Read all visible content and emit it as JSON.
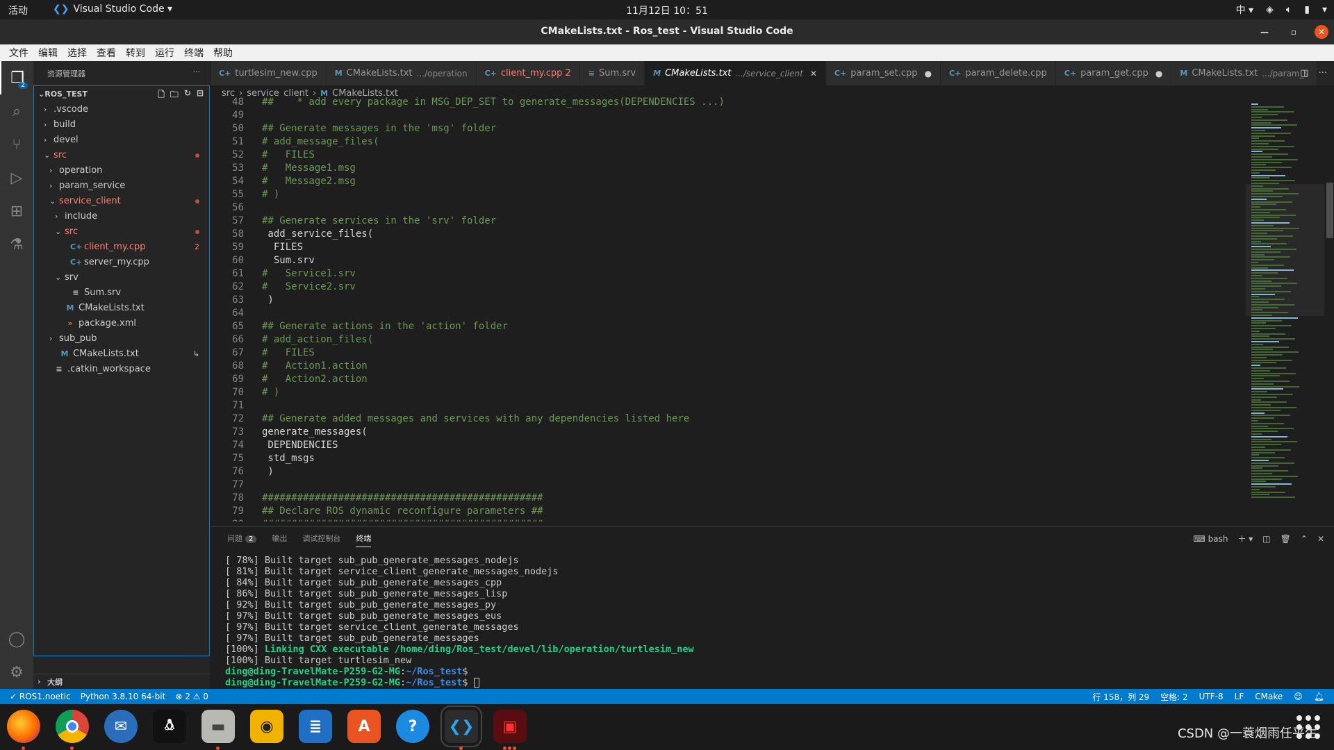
{
  "topbar": {
    "activities": "活动",
    "app_name": "Visual Studio Code ▾",
    "clock": "11月12日  10：51",
    "input_method": "中 ▾"
  },
  "window": {
    "title": "CMakeLists.txt - Ros_test - Visual Studio Code"
  },
  "menu": [
    "文件",
    "编辑",
    "选择",
    "查看",
    "转到",
    "运行",
    "终端",
    "帮助"
  ],
  "activity": {
    "explorer_badge": "2"
  },
  "sidebar": {
    "header": "资源管理器",
    "more": "···",
    "section": "ROS_TEST",
    "outline": "大纲",
    "tree": [
      {
        "depth": 0,
        "label": ".vscode",
        "chev": "›",
        "icon": "",
        "cls": ""
      },
      {
        "depth": 0,
        "label": "build",
        "chev": "›",
        "icon": "",
        "cls": ""
      },
      {
        "depth": 0,
        "label": "devel",
        "chev": "›",
        "icon": "",
        "cls": ""
      },
      {
        "depth": 0,
        "label": "src",
        "chev": "⌄",
        "icon": "",
        "cls": "err",
        "deco": "dot"
      },
      {
        "depth": 1,
        "label": "operation",
        "chev": "›",
        "icon": "",
        "cls": ""
      },
      {
        "depth": 1,
        "label": "param_service",
        "chev": "›",
        "icon": "",
        "cls": ""
      },
      {
        "depth": 1,
        "label": "service_client",
        "chev": "⌄",
        "icon": "",
        "cls": "err",
        "deco": "dot"
      },
      {
        "depth": 2,
        "label": "include",
        "chev": "›",
        "icon": "",
        "cls": ""
      },
      {
        "depth": 2,
        "label": "src",
        "chev": "⌄",
        "icon": "",
        "cls": "err",
        "deco": "dot"
      },
      {
        "depth": 3,
        "label": "client_my.cpp",
        "chev": "",
        "icon": "C+",
        "cls": "err",
        "deco": "2"
      },
      {
        "depth": 3,
        "label": "server_my.cpp",
        "chev": "",
        "icon": "C+",
        "cls": ""
      },
      {
        "depth": 2,
        "label": "srv",
        "chev": "⌄",
        "icon": "",
        "cls": ""
      },
      {
        "depth": 3,
        "label": "Sum.srv",
        "chev": "",
        "icon": "≡",
        "cls": ""
      },
      {
        "depth": 2,
        "label": "CMakeLists.txt",
        "chev": "",
        "icon": "M",
        "cls": ""
      },
      {
        "depth": 2,
        "label": "package.xml",
        "chev": "",
        "icon": "»",
        "cls": ""
      },
      {
        "depth": 1,
        "label": "sub_pub",
        "chev": "›",
        "icon": "",
        "cls": ""
      },
      {
        "depth": 1,
        "label": "CMakeLists.txt",
        "chev": "",
        "icon": "M",
        "cls": "",
        "deco": "↳"
      },
      {
        "depth": 0,
        "label": ".catkin_workspace",
        "chev": "",
        "icon": "≡",
        "cls": ""
      }
    ]
  },
  "tabs": [
    {
      "label": "turtlesim_new.cpp",
      "icon": "C+",
      "desc": "",
      "state": ""
    },
    {
      "label": "CMakeLists.txt",
      "icon": "M",
      "desc": ".../operation",
      "state": ""
    },
    {
      "label": "client_my.cpp 2",
      "icon": "C+",
      "desc": "",
      "state": "",
      "error": true
    },
    {
      "label": "Sum.srv",
      "icon": "≡",
      "desc": "",
      "state": ""
    },
    {
      "label": "CMakeLists.txt",
      "icon": "M",
      "desc": ".../service_client",
      "state": "✕",
      "active": true
    },
    {
      "label": "param_set.cpp",
      "icon": "C+",
      "desc": "",
      "state": "●"
    },
    {
      "label": "param_delete.cpp",
      "icon": "C+",
      "desc": "",
      "state": ""
    },
    {
      "label": "param_get.cpp",
      "icon": "C+",
      "desc": "",
      "state": "●"
    },
    {
      "label": "CMakeLists.txt",
      "icon": "M",
      "desc": ".../param_s",
      "state": ""
    }
  ],
  "breadcrumb": [
    "src",
    "›",
    "service_client",
    "›",
    "M",
    "CMakeLists.txt"
  ],
  "editor": {
    "lines": [
      {
        "n": "48",
        "t": "##    * add every package in MSG_DEP_SET to generate_messages(DEPENDENCIES ...)",
        "c": true
      },
      {
        "n": "49",
        "t": "",
        "c": false
      },
      {
        "n": "50",
        "t": "## Generate messages in the 'msg' folder",
        "c": true
      },
      {
        "n": "51",
        "t": "# add_message_files(",
        "c": true
      },
      {
        "n": "52",
        "t": "#   FILES",
        "c": true
      },
      {
        "n": "53",
        "t": "#   Message1.msg",
        "c": true
      },
      {
        "n": "54",
        "t": "#   Message2.msg",
        "c": true
      },
      {
        "n": "55",
        "t": "# )",
        "c": true
      },
      {
        "n": "56",
        "t": "",
        "c": false
      },
      {
        "n": "57",
        "t": "## Generate services in the 'srv' folder",
        "c": true
      },
      {
        "n": "58",
        "t": " add_service_files(",
        "c": false
      },
      {
        "n": "59",
        "t": "  FILES",
        "c": false
      },
      {
        "n": "60",
        "t": "  Sum.srv",
        "c": false
      },
      {
        "n": "61",
        "t": "#   Service1.srv",
        "c": true
      },
      {
        "n": "62",
        "t": "#   Service2.srv",
        "c": true
      },
      {
        "n": "63",
        "t": " )",
        "c": false
      },
      {
        "n": "64",
        "t": "",
        "c": false
      },
      {
        "n": "65",
        "t": "## Generate actions in the 'action' folder",
        "c": true
      },
      {
        "n": "66",
        "t": "# add_action_files(",
        "c": true
      },
      {
        "n": "67",
        "t": "#   FILES",
        "c": true
      },
      {
        "n": "68",
        "t": "#   Action1.action",
        "c": true
      },
      {
        "n": "69",
        "t": "#   Action2.action",
        "c": true
      },
      {
        "n": "70",
        "t": "# )",
        "c": true
      },
      {
        "n": "71",
        "t": "",
        "c": false
      },
      {
        "n": "72",
        "t": "## Generate added messages and services with any dependencies listed here",
        "c": true
      },
      {
        "n": "73",
        "t": "generate_messages(",
        "c": false
      },
      {
        "n": "74",
        "t": " DEPENDENCIES",
        "c": false
      },
      {
        "n": "75",
        "t": " std_msgs",
        "c": false
      },
      {
        "n": "76",
        "t": " )",
        "c": false
      },
      {
        "n": "77",
        "t": "",
        "c": false
      },
      {
        "n": "78",
        "t": "################################################",
        "c": true
      },
      {
        "n": "79",
        "t": "## Declare ROS dynamic reconfigure parameters ##",
        "c": true
      },
      {
        "n": "80",
        "t": "################################################",
        "c": true
      }
    ]
  },
  "panel": {
    "tabs": [
      "问题",
      "输出",
      "调试控制台",
      "终端"
    ],
    "problems_count": "2",
    "shell": "bash",
    "terminal": [
      {
        "t": "[ 78%] Built target sub_pub_generate_messages_nodejs"
      },
      {
        "t": "[ 81%] Built target service_client_generate_messages_nodejs"
      },
      {
        "t": "[ 84%] Built target sub_pub_generate_messages_cpp"
      },
      {
        "t": "[ 86%] Built target sub_pub_generate_messages_lisp"
      },
      {
        "t": "[ 92%] Built target sub_pub_generate_messages_py"
      },
      {
        "t": "[ 97%] Built target sub_pub_generate_messages_eus"
      },
      {
        "t": "[ 97%] Built target service_client_generate_messages"
      },
      {
        "t": "[ 97%] Built target sub_pub_generate_messages"
      },
      {
        "t": "[100%] ",
        "g": "Linking CXX executable /home/ding/Ros_test/devel/lib/operation/turtlesim_new"
      },
      {
        "t": "[100%] Built target turtlesim_new"
      }
    ],
    "prompt_user": "ding@ding-TravelMate-P259-G2-MG",
    "prompt_path": "~/Ros_test"
  },
  "status": {
    "remote": "✓ ROS1.noetic",
    "python": "Python 3.8.10 64-bit",
    "problems": "⊗ 2 ⚠ 0",
    "position": "行 158，列 29",
    "spaces": "空格: 2",
    "encoding": "UTF-8",
    "eol": "LF",
    "language": "CMake"
  },
  "watermark": "CSDN @一蓑烟雨任平生",
  "colors": {
    "accent": "#007acc",
    "comment": "#6a9955",
    "terminal_green": "#23d18b",
    "error": "#f88070"
  }
}
